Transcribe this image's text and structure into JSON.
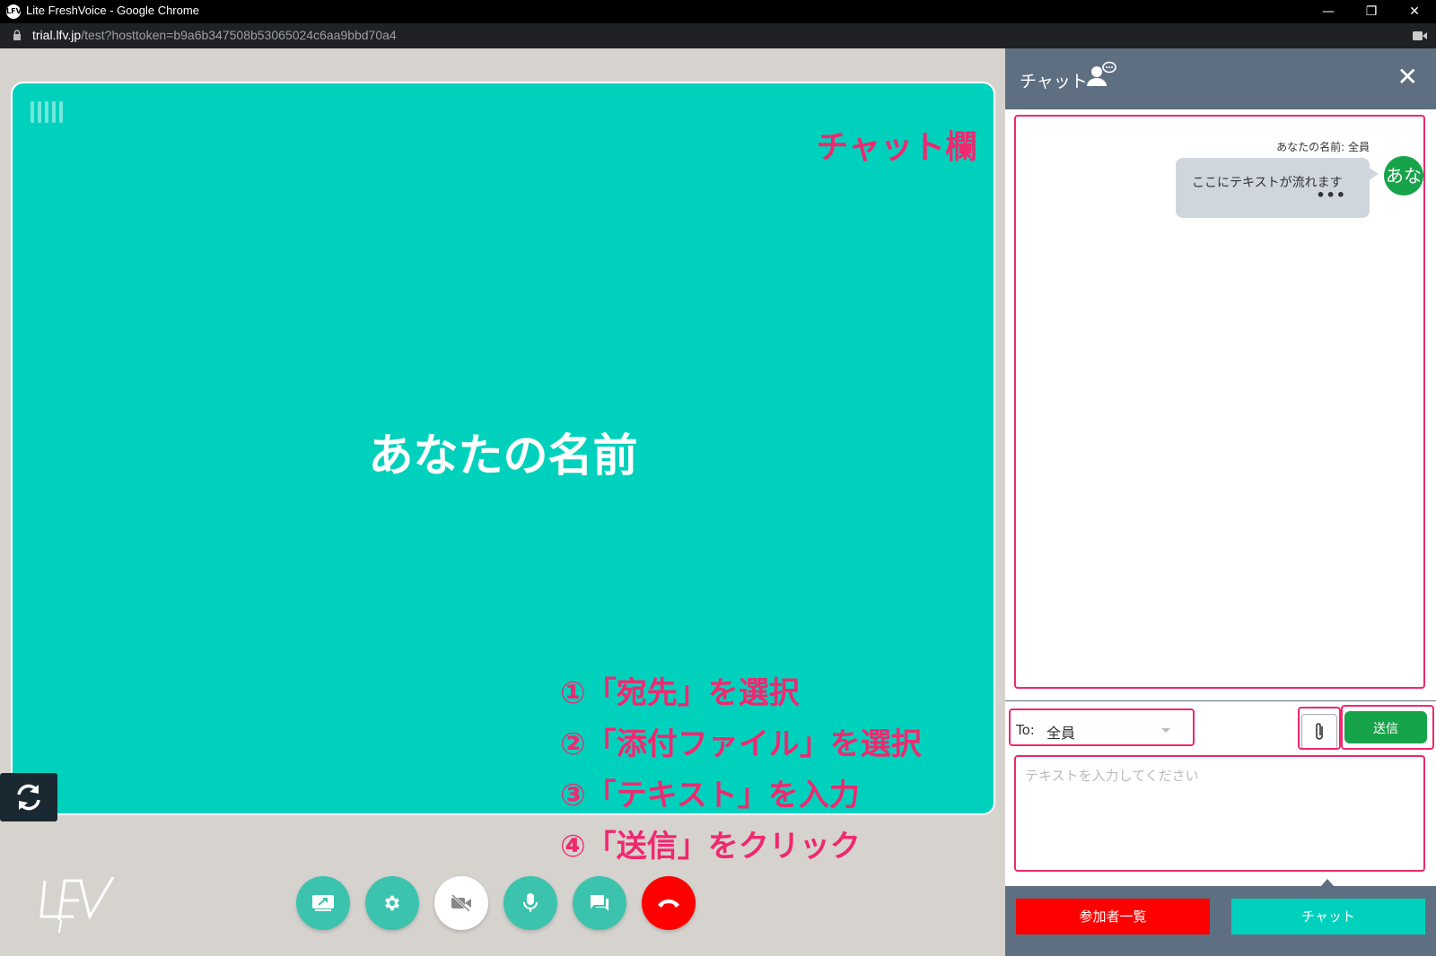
{
  "window": {
    "title": "Lite FreshVoice - Google Chrome",
    "url_host": "trial.lfv.jp",
    "url_path": "/test?hosttoken=b9a6b347508b53065024c6aa9bbd70a4",
    "minimize": "—",
    "restore": "❐",
    "close": "✕"
  },
  "video": {
    "name": "あなたの名前",
    "annotation_chat": "チャット欄"
  },
  "annotations": [
    "①「宛先」を選択",
    "②「添付ファイル」を選択",
    "③「テキスト」を入力",
    "④「送信」をクリック"
  ],
  "chat": {
    "header_title": "チャット",
    "close": "✕",
    "message": {
      "sender": "あなたの名前: 全員",
      "text": "ここにテキストが流れます",
      "dots": "•••",
      "avatar": "あなたの名前"
    },
    "to_label": "To:",
    "to_value": "全員",
    "send_label": "送信",
    "input_placeholder": "テキストを入力してください",
    "participants_button": "参加者一覧",
    "chat_button": "チャット"
  },
  "colors": {
    "video_bg": "#00d1bd",
    "accent_pink": "#f0286f",
    "send_green": "#17a34a",
    "hangup_red": "#ff0000",
    "header_slate": "#5f6f82"
  },
  "icons": [
    "screen-share-icon",
    "gear-icon",
    "camera-off-icon",
    "microphone-icon",
    "chat-icon",
    "hangup-icon",
    "rotate-icon",
    "paperclip-icon",
    "user-chat-icon",
    "lock-icon",
    "camera-icon"
  ]
}
